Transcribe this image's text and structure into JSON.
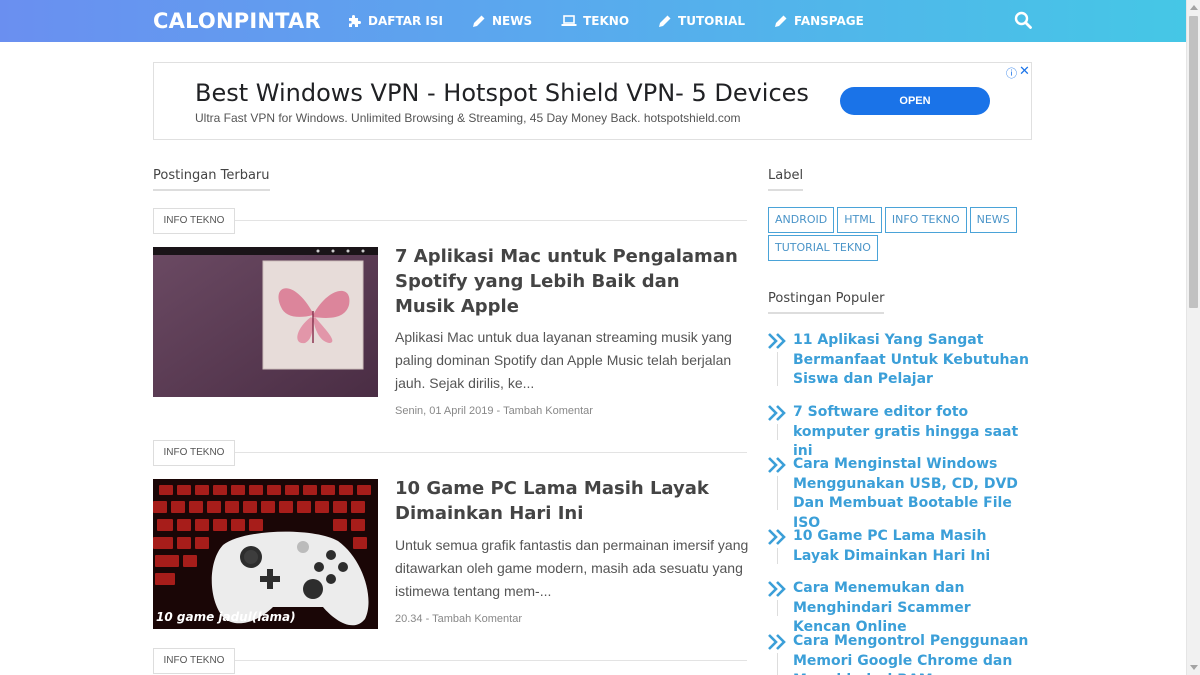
{
  "header": {
    "brand": "CALONPINTAR",
    "nav": [
      {
        "label": "DAFTAR ISI",
        "icon": "puzzle-icon"
      },
      {
        "label": "NEWS",
        "icon": "pencil-icon"
      },
      {
        "label": "TEKNO",
        "icon": "laptop-icon"
      },
      {
        "label": "TUTORIAL",
        "icon": "pencil-icon"
      },
      {
        "label": "FANSPAGE",
        "icon": "pencil-icon"
      }
    ]
  },
  "ad": {
    "title": "Best Windows VPN - Hotspot Shield VPN- 5 Devices",
    "description": "Ultra Fast VPN for Windows. Unlimited Browsing & Streaming, 45 Day Money Back. hotspotshield.com",
    "cta": "OPEN",
    "info": "ⓘ",
    "close": "✕"
  },
  "main": {
    "heading": "Postingan Terbaru",
    "posts": [
      {
        "tag": "INFO TEKNO",
        "title": "7 Aplikasi Mac untuk Pengalaman Spotify yang Lebih Baik dan Musik Apple",
        "excerpt": "Aplikasi Mac untuk dua layanan streaming musik yang paling dominan Spotify dan Apple Music telah berjalan jauh. Sejak dirilis, ke...",
        "date": "Senin, 01 April 2019",
        "comments": "Tambah Komentar"
      },
      {
        "tag": "INFO TEKNO",
        "title": "10 Game PC Lama Masih Layak Dimainkan Hari Ini",
        "excerpt": "Untuk semua grafik fantastis dan permainan imersif yang ditawarkan oleh game modern, masih ada sesuatu yang istimewa tentang mem-...",
        "date": "20.34",
        "comments": "Tambah Komentar",
        "thumb_caption": "10 game jadul(lama)"
      },
      {
        "tag": "INFO TEKNO"
      }
    ]
  },
  "sidebar": {
    "labels_heading": "Label",
    "labels": [
      "ANDROID",
      "HTML",
      "INFO TEKNO",
      "NEWS",
      "TUTORIAL TEKNO"
    ],
    "popular_heading": "Postingan Populer",
    "popular": [
      "11 Aplikasi Yang Sangat Bermanfaat Untuk Kebutuhan Siswa dan Pelajar",
      "7 Software editor foto komputer gratis hingga saat ini",
      "Cara Menginstal Windows Menggunakan USB, CD, DVD Dan Membuat Bootable File ISO",
      "10 Game PC Lama Masih Layak Dimainkan Hari Ini",
      "Cara Menemukan dan Menghindari Scammer Kencan Online",
      "Cara Mengontrol Penggunaan Memori Google Chrome dan Menghindari RAM..."
    ]
  },
  "colors": {
    "accent": "#3b9fd8",
    "ad_button": "#1a73e8",
    "header_start": "#6a8ff0",
    "header_end": "#45c7e6"
  }
}
